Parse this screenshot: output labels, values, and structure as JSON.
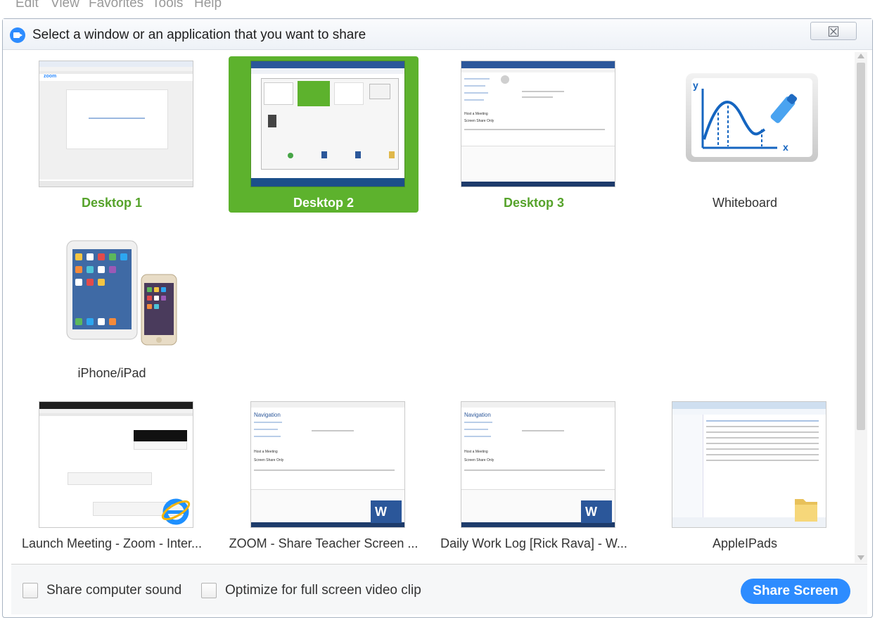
{
  "menubar": {
    "items": [
      "Edit",
      "View",
      "Favorites",
      "Tools",
      "Help"
    ]
  },
  "dialog": {
    "title": "Select a window or an application that you want to share",
    "close_glyph": "☒"
  },
  "tiles": [
    {
      "label": "Desktop 1",
      "selected": false,
      "style": "green"
    },
    {
      "label": "Desktop 2",
      "selected": true,
      "style": "green"
    },
    {
      "label": "Desktop 3",
      "selected": false,
      "style": "green"
    },
    {
      "label": "Whiteboard",
      "selected": false,
      "style": "normal"
    },
    {
      "label": "iPhone/iPad",
      "selected": false,
      "style": "normal"
    },
    {
      "label": "Launch Meeting - Zoom - Inter...",
      "selected": false,
      "style": "normal"
    },
    {
      "label": "ZOOM - Share Teacher Screen ...",
      "selected": false,
      "style": "normal"
    },
    {
      "label": "Daily Work Log [Rick Rava] - W...",
      "selected": false,
      "style": "normal"
    },
    {
      "label": "AppleIPads",
      "selected": false,
      "style": "normal"
    }
  ],
  "thumb_text": {
    "zoom_logo": "zoom",
    "host_meeting": "Host a Meeting",
    "screen_share": "Screen Share Only",
    "navigation": "Navigation",
    "word_badge": "W"
  },
  "footer": {
    "share_sound_label": "Share computer sound",
    "optimize_label": "Optimize for full screen video clip",
    "share_button": "Share Screen"
  },
  "colors": {
    "accent": "#2d8cff",
    "selected": "#5db22d",
    "green_label": "#56a32b"
  }
}
